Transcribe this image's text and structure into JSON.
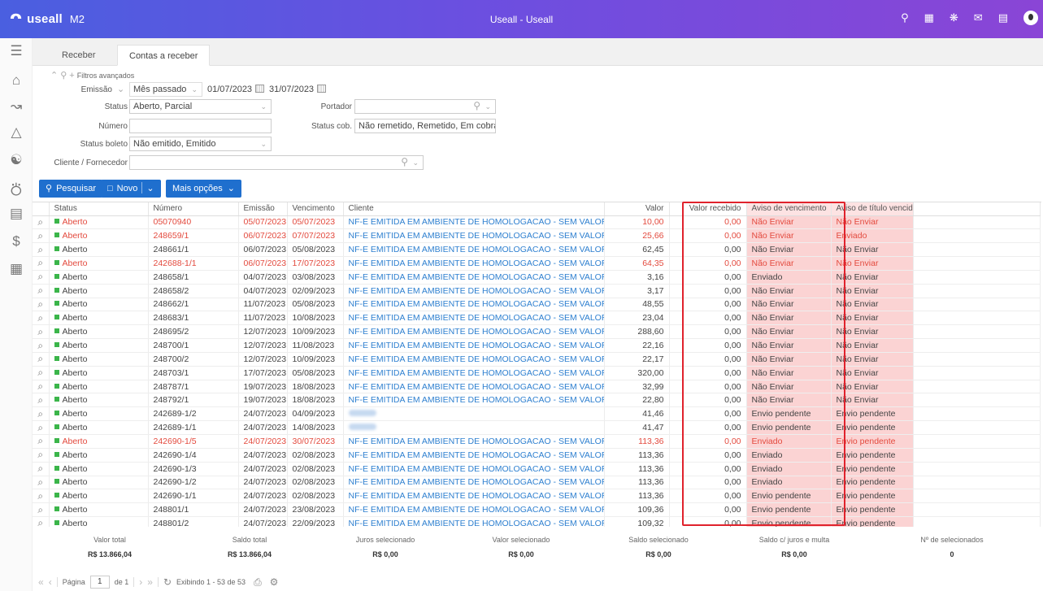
{
  "header": {
    "logo_mark": "ᴖ",
    "logo_text": "useall",
    "logo_version": "M2",
    "title": "Useall - Useall",
    "icons": [
      "search-icon",
      "apps-icon",
      "alert-icon",
      "mail-icon",
      "chat-icon",
      "user-avatar"
    ]
  },
  "sidebar": {
    "icons": [
      "menu-icon",
      "home-icon",
      "chart-icon",
      "basket-icon",
      "users-icon",
      "cart-icon",
      "card-icon",
      "dollar-icon",
      "calculator-icon"
    ]
  },
  "tabs": [
    {
      "label": "Receber"
    },
    {
      "label": "Contas a receber"
    }
  ],
  "filters": {
    "toggle_label": "Filtros avançados",
    "emissao_label": "Emissão",
    "emissao_period": "Mês passado",
    "emissao_from": "01/07/2023",
    "emissao_to": "31/07/2023",
    "status_label": "Status",
    "status_value": "Aberto, Parcial",
    "portador_label": "Portador",
    "portador_value": "",
    "numero_label": "Número",
    "numero_value": "",
    "status_cob_label": "Status cob.",
    "status_cob_value": "Não remetido, Remetido, Em cobra",
    "status_boleto_label": "Status boleto",
    "status_boleto_value": "Não emitido, Emitido",
    "cliente_label": "Cliente / Fornecedor",
    "cliente_value": ""
  },
  "toolbar": {
    "search_label": "Pesquisar",
    "new_label": "Novo",
    "more_label": "Mais opções"
  },
  "columns": [
    "Status",
    "Número",
    "Emissão",
    "Vencimento",
    "Cliente",
    "Valor",
    "Valor recebido",
    "Aviso de vencimento",
    "Aviso de título vencido"
  ],
  "rows": [
    {
      "status": "Aberto",
      "numero": "05070940",
      "emissao": "05/07/2023",
      "vencimento": "05/07/2023",
      "cliente": "NF-E EMITIDA EM AMBIENTE DE HOMOLOGACAO - SEM VALOR FISCAL",
      "valor": "10,00",
      "recebido": "0,00",
      "aviso_venc": "Não Enviar",
      "aviso_vencido": "Não Enviar",
      "late": true
    },
    {
      "status": "Aberto",
      "numero": "248659/1",
      "emissao": "06/07/2023",
      "vencimento": "07/07/2023",
      "cliente": "NF-E EMITIDA EM AMBIENTE DE HOMOLOGACAO - SEM VALOR FISCAL",
      "valor": "25,66",
      "recebido": "0,00",
      "aviso_venc": "Não Enviar",
      "aviso_vencido": "Enviado",
      "late": true
    },
    {
      "status": "Aberto",
      "numero": "248661/1",
      "emissao": "06/07/2023",
      "vencimento": "05/08/2023",
      "cliente": "NF-E EMITIDA EM AMBIENTE DE HOMOLOGACAO - SEM VALOR FISCAL",
      "valor": "62,45",
      "recebido": "0,00",
      "aviso_venc": "Não Enviar",
      "aviso_vencido": "Não Enviar",
      "late": false
    },
    {
      "status": "Aberto",
      "numero": "242688-1/1",
      "emissao": "06/07/2023",
      "vencimento": "17/07/2023",
      "cliente": "NF-E EMITIDA EM AMBIENTE DE HOMOLOGACAO - SEM VALOR FISCAL",
      "valor": "64,35",
      "recebido": "0,00",
      "aviso_venc": "Não Enviar",
      "aviso_vencido": "Não Enviar",
      "late": true
    },
    {
      "status": "Aberto",
      "numero": "248658/1",
      "emissao": "04/07/2023",
      "vencimento": "03/08/2023",
      "cliente": "NF-E EMITIDA EM AMBIENTE DE HOMOLOGACAO - SEM VALOR FISCAL",
      "valor": "3,16",
      "recebido": "0,00",
      "aviso_venc": "Enviado",
      "aviso_vencido": "Não Enviar",
      "late": false
    },
    {
      "status": "Aberto",
      "numero": "248658/2",
      "emissao": "04/07/2023",
      "vencimento": "02/09/2023",
      "cliente": "NF-E EMITIDA EM AMBIENTE DE HOMOLOGACAO - SEM VALOR FISCAL",
      "valor": "3,17",
      "recebido": "0,00",
      "aviso_venc": "Não Enviar",
      "aviso_vencido": "Não Enviar",
      "late": false
    },
    {
      "status": "Aberto",
      "numero": "248662/1",
      "emissao": "11/07/2023",
      "vencimento": "05/08/2023",
      "cliente": "NF-E EMITIDA EM AMBIENTE DE HOMOLOGACAO - SEM VALOR FISCAL",
      "valor": "48,55",
      "recebido": "0,00",
      "aviso_venc": "Não Enviar",
      "aviso_vencido": "Não Enviar",
      "late": false
    },
    {
      "status": "Aberto",
      "numero": "248683/1",
      "emissao": "11/07/2023",
      "vencimento": "10/08/2023",
      "cliente": "NF-E EMITIDA EM AMBIENTE DE HOMOLOGACAO - SEM VALOR FISCAL",
      "valor": "23,04",
      "recebido": "0,00",
      "aviso_venc": "Não Enviar",
      "aviso_vencido": "Não Enviar",
      "late": false
    },
    {
      "status": "Aberto",
      "numero": "248695/2",
      "emissao": "12/07/2023",
      "vencimento": "10/09/2023",
      "cliente": "NF-E EMITIDA EM AMBIENTE DE HOMOLOGACAO - SEM VALOR FISCAL",
      "valor": "288,60",
      "recebido": "0,00",
      "aviso_venc": "Não Enviar",
      "aviso_vencido": "Não Enviar",
      "late": false
    },
    {
      "status": "Aberto",
      "numero": "248700/1",
      "emissao": "12/07/2023",
      "vencimento": "11/08/2023",
      "cliente": "NF-E EMITIDA EM AMBIENTE DE HOMOLOGACAO - SEM VALOR FISCAL",
      "valor": "22,16",
      "recebido": "0,00",
      "aviso_venc": "Não Enviar",
      "aviso_vencido": "Não Enviar",
      "late": false
    },
    {
      "status": "Aberto",
      "numero": "248700/2",
      "emissao": "12/07/2023",
      "vencimento": "10/09/2023",
      "cliente": "NF-E EMITIDA EM AMBIENTE DE HOMOLOGACAO - SEM VALOR FISCAL",
      "valor": "22,17",
      "recebido": "0,00",
      "aviso_venc": "Não Enviar",
      "aviso_vencido": "Não Enviar",
      "late": false
    },
    {
      "status": "Aberto",
      "numero": "248703/1",
      "emissao": "17/07/2023",
      "vencimento": "05/08/2023",
      "cliente": "NF-E EMITIDA EM AMBIENTE DE HOMOLOGACAO - SEM VALOR FISCAL",
      "valor": "320,00",
      "recebido": "0,00",
      "aviso_venc": "Não Enviar",
      "aviso_vencido": "Não Enviar",
      "late": false
    },
    {
      "status": "Aberto",
      "numero": "248787/1",
      "emissao": "19/07/2023",
      "vencimento": "18/08/2023",
      "cliente": "NF-E EMITIDA EM AMBIENTE DE HOMOLOGACAO - SEM VALOR FISCAL",
      "valor": "32,99",
      "recebido": "0,00",
      "aviso_venc": "Não Enviar",
      "aviso_vencido": "Não Enviar",
      "late": false
    },
    {
      "status": "Aberto",
      "numero": "248792/1",
      "emissao": "19/07/2023",
      "vencimento": "18/08/2023",
      "cliente": "NF-E EMITIDA EM AMBIENTE DE HOMOLOGACAO - SEM VALOR FISCAL",
      "valor": "22,80",
      "recebido": "0,00",
      "aviso_venc": "Não Enviar",
      "aviso_vencido": "Não Enviar",
      "late": false
    },
    {
      "status": "Aberto",
      "numero": "242689-1/2",
      "emissao": "24/07/2023",
      "vencimento": "04/09/2023",
      "cliente": "",
      "valor": "41,46",
      "recebido": "0,00",
      "aviso_venc": "Envio pendente",
      "aviso_vencido": "Envio pendente",
      "late": false
    },
    {
      "status": "Aberto",
      "numero": "242689-1/1",
      "emissao": "24/07/2023",
      "vencimento": "14/08/2023",
      "cliente": "",
      "valor": "41,47",
      "recebido": "0,00",
      "aviso_venc": "Envio pendente",
      "aviso_vencido": "Envio pendente",
      "late": false
    },
    {
      "status": "Aberto",
      "numero": "242690-1/5",
      "emissao": "24/07/2023",
      "vencimento": "30/07/2023",
      "cliente": "NF-E EMITIDA EM AMBIENTE DE HOMOLOGACAO - SEM VALOR FISCAL",
      "valor": "113,36",
      "recebido": "0,00",
      "aviso_venc": "Enviado",
      "aviso_vencido": "Envio pendente",
      "late": true
    },
    {
      "status": "Aberto",
      "numero": "242690-1/4",
      "emissao": "24/07/2023",
      "vencimento": "02/08/2023",
      "cliente": "NF-E EMITIDA EM AMBIENTE DE HOMOLOGACAO - SEM VALOR FISCAL",
      "valor": "113,36",
      "recebido": "0,00",
      "aviso_venc": "Enviado",
      "aviso_vencido": "Envio pendente",
      "late": false
    },
    {
      "status": "Aberto",
      "numero": "242690-1/3",
      "emissao": "24/07/2023",
      "vencimento": "02/08/2023",
      "cliente": "NF-E EMITIDA EM AMBIENTE DE HOMOLOGACAO - SEM VALOR FISCAL",
      "valor": "113,36",
      "recebido": "0,00",
      "aviso_venc": "Enviado",
      "aviso_vencido": "Envio pendente",
      "late": false
    },
    {
      "status": "Aberto",
      "numero": "242690-1/2",
      "emissao": "24/07/2023",
      "vencimento": "02/08/2023",
      "cliente": "NF-E EMITIDA EM AMBIENTE DE HOMOLOGACAO - SEM VALOR FISCAL",
      "valor": "113,36",
      "recebido": "0,00",
      "aviso_venc": "Enviado",
      "aviso_vencido": "Envio pendente",
      "late": false
    },
    {
      "status": "Aberto",
      "numero": "242690-1/1",
      "emissao": "24/07/2023",
      "vencimento": "02/08/2023",
      "cliente": "NF-E EMITIDA EM AMBIENTE DE HOMOLOGACAO - SEM VALOR FISCAL",
      "valor": "113,36",
      "recebido": "0,00",
      "aviso_venc": "Envio pendente",
      "aviso_vencido": "Envio pendente",
      "late": false
    },
    {
      "status": "Aberto",
      "numero": "248801/1",
      "emissao": "24/07/2023",
      "vencimento": "23/08/2023",
      "cliente": "NF-E EMITIDA EM AMBIENTE DE HOMOLOGACAO - SEM VALOR FISCAL",
      "valor": "109,36",
      "recebido": "0,00",
      "aviso_venc": "Envio pendente",
      "aviso_vencido": "Envio pendente",
      "late": false
    },
    {
      "status": "Aberto",
      "numero": "248801/2",
      "emissao": "24/07/2023",
      "vencimento": "22/09/2023",
      "cliente": "NF-E EMITIDA EM AMBIENTE DE HOMOLOGACAO - SEM VALOR FISCAL",
      "valor": "109,32",
      "recebido": "0,00",
      "aviso_venc": "Envio pendente",
      "aviso_vencido": "Envio pendente",
      "late": false
    }
  ],
  "totals": {
    "valor_total_label": "Valor total",
    "valor_total": "R$ 13.866,04",
    "saldo_total_label": "Saldo total",
    "saldo_total": "R$ 13.866,04",
    "juros_label": "Juros selecionado",
    "juros": "R$ 0,00",
    "valor_sel_label": "Valor selecionado",
    "valor_sel": "R$ 0,00",
    "saldo_sel_label": "Saldo selecionado",
    "saldo_sel": "R$ 0,00",
    "saldo_juros_label": "Saldo c/ juros e multa",
    "saldo_juros": "R$ 0,00",
    "n_sel_label": "Nº de selecionados",
    "n_sel": "0"
  },
  "pager": {
    "page_label": "Página",
    "page": "1",
    "of_label": "de 1",
    "showing": "Exibindo 1 - 53 de 53"
  },
  "colors": {
    "accent": "#1f6fce",
    "header_start": "#4a5fe0",
    "header_end": "#8a45d6",
    "late_text": "#e34a3e",
    "highlight": "#fbd3d3",
    "highlight_border": "#e0222c"
  }
}
